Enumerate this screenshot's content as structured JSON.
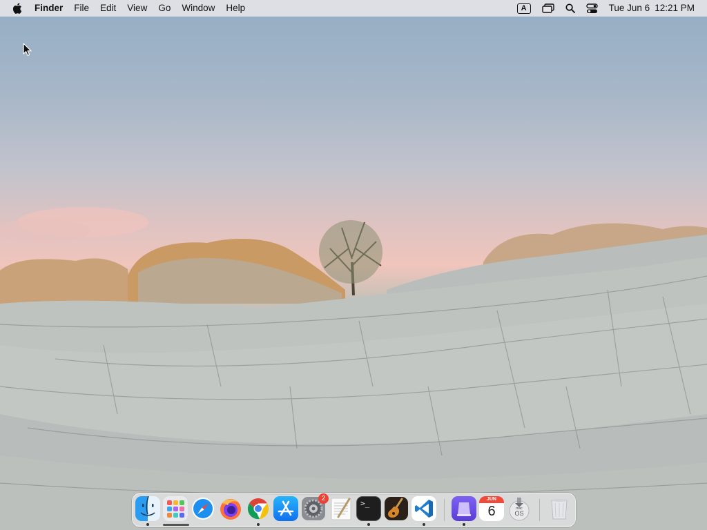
{
  "menubar": {
    "app_name": "Finder",
    "menus": [
      "File",
      "Edit",
      "View",
      "Go",
      "Window",
      "Help"
    ],
    "status": {
      "input_source": "A",
      "date": "Tue Jun 6",
      "time": "12:21 PM"
    }
  },
  "dock": {
    "apps": [
      {
        "name": "Finder",
        "icon": "finder-icon",
        "running": true
      },
      {
        "name": "Launchpad",
        "icon": "launchpad-icon",
        "running": false
      },
      {
        "name": "Safari",
        "icon": "safari-icon",
        "running": false
      },
      {
        "name": "Firefox",
        "icon": "firefox-icon",
        "running": false
      },
      {
        "name": "Google Chrome",
        "icon": "chrome-icon",
        "running": true
      },
      {
        "name": "App Store",
        "icon": "app-store-icon",
        "running": false
      },
      {
        "name": "System Preferences",
        "icon": "system-preferences-icon",
        "running": false
      },
      {
        "name": "TextEdit",
        "icon": "textedit-icon",
        "running": false
      },
      {
        "name": "Terminal",
        "icon": "terminal-icon",
        "running": true
      },
      {
        "name": "GarageBand",
        "icon": "garageband-icon",
        "running": false
      },
      {
        "name": "Visual Studio Code",
        "icon": "vscode-icon",
        "running": true
      },
      {
        "name": "Simulator",
        "icon": "simulator-icon",
        "running": true
      },
      {
        "name": "Calendar",
        "icon": "calendar-icon",
        "running": false
      },
      {
        "name": "macOS Installer",
        "icon": "macos-installer-icon",
        "running": false
      },
      {
        "name": "Trash",
        "icon": "trash-icon",
        "running": false
      }
    ],
    "system_preferences_badge": "2",
    "calendar_month": "JUN",
    "calendar_day": "6",
    "terminal_prompt": ">_",
    "installer_label_top": "mac",
    "installer_label_bottom": "OS"
  },
  "colors": {
    "sky_top": "#93adc4",
    "horizon_glow": "#f0c5bc",
    "rock": "#c0c4c0",
    "rock_warm": "#c9975e",
    "badge_red": "#ee4136"
  }
}
